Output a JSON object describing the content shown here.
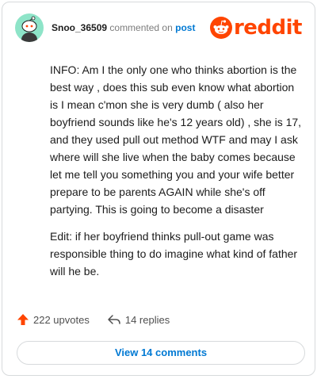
{
  "header": {
    "username": "Snoo_36509",
    "action_text": "commented on",
    "post_link": "post",
    "avatar_icon": "snoo-avatar-icon",
    "logo_icon": "reddit-alien-icon",
    "logo_text": "reddit"
  },
  "comment": {
    "paragraphs": [
      "INFO: Am I the only one who thinks abortion is the best way , does this sub even know what abortion is I mean c'mon she is very dumb ( also her boyfriend sounds like he's 12 years old) , she is 17, and they used pull out method WTF and may I ask where will she live when the baby comes because let me tell you something you and your wife better prepare to be parents AGAIN while she's off partying. This is going to become a disaster",
      "Edit: if her boyfriend thinks pull-out game was responsible thing to do imagine what kind of father will he be."
    ]
  },
  "actions": {
    "upvotes": "222 upvotes",
    "upvote_icon": "upvote-arrow-icon",
    "replies": "14 replies",
    "reply_icon": "reply-arrow-icon"
  },
  "footer": {
    "view_comments_label": "View 14 comments"
  },
  "colors": {
    "brand": "#ff4500",
    "link": "#0079d3",
    "avatar": "#8ee4c8",
    "border": "#d7dadc"
  }
}
